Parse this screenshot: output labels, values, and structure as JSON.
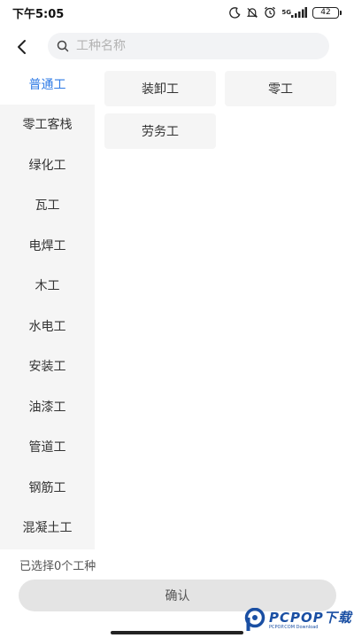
{
  "status_bar": {
    "time": "下午5:05",
    "network_tag": "5G",
    "battery": "42"
  },
  "header": {
    "search_placeholder": "工种名称"
  },
  "sidebar": {
    "items": [
      {
        "label": "普通工",
        "active": true
      },
      {
        "label": "零工客栈",
        "active": false
      },
      {
        "label": "绿化工",
        "active": false
      },
      {
        "label": "瓦工",
        "active": false
      },
      {
        "label": "电焊工",
        "active": false
      },
      {
        "label": "木工",
        "active": false
      },
      {
        "label": "水电工",
        "active": false
      },
      {
        "label": "安装工",
        "active": false
      },
      {
        "label": "油漆工",
        "active": false
      },
      {
        "label": "管道工",
        "active": false
      },
      {
        "label": "钢筋工",
        "active": false
      },
      {
        "label": "混凝土工",
        "active": false
      }
    ]
  },
  "main": {
    "options": [
      {
        "label": "装卸工"
      },
      {
        "label": "零工"
      },
      {
        "label": "劳务工"
      }
    ]
  },
  "footer": {
    "selected_text": "已选择0个工种",
    "confirm_label": "确认"
  },
  "watermark": {
    "main": "PCPOP下载",
    "sub": "PCPOP.COM Download"
  },
  "colors": {
    "accent": "#2f7be6",
    "sidebar_bg": "#f5f5f5",
    "chip_bg": "#f5f5f5",
    "confirm_bg": "#e4e4e4",
    "watermark": "#1a4fa3"
  },
  "icons": {
    "back": "chevron-left-icon",
    "search": "search-icon",
    "moon": "moon-icon",
    "mute": "mute-icon",
    "alarm": "alarm-icon",
    "signal": "signal-icon",
    "battery": "battery-icon"
  }
}
